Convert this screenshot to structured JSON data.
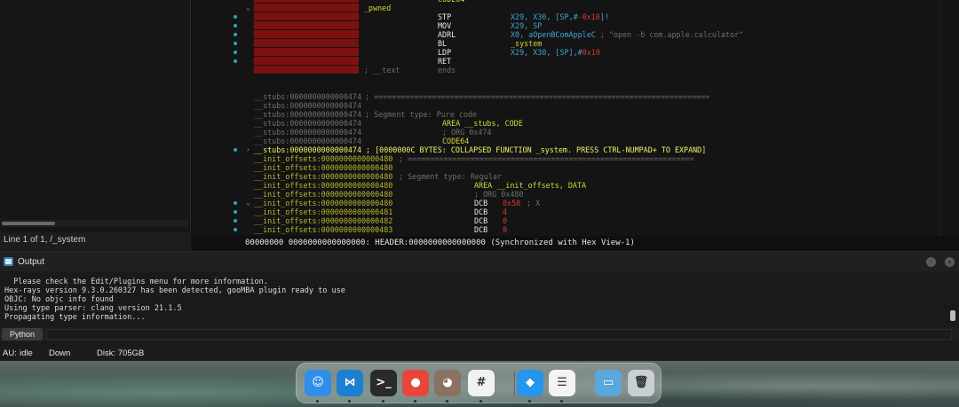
{
  "left_pane": {
    "status": "Line 1 of 1, /_system"
  },
  "disasm": {
    "top_lines": [
      {
        "label": "",
        "mnem": "",
        "ops": "CODE64",
        "ops_kind": "label"
      },
      {
        "label": "_pwned",
        "mnem": "",
        "ops": "",
        "ops_kind": ""
      },
      {
        "label": "",
        "mnem": "STP",
        "ops": "X29, X30, [SP,#-0x10]!",
        "ops_kind": "reg"
      },
      {
        "label": "",
        "mnem": "MOV",
        "ops": "X29, SP",
        "ops_kind": "reg"
      },
      {
        "label": "",
        "mnem": "ADRL",
        "ops": "X0, aOpenBComAppleC ; \"open -b com.apple.calculator\"",
        "ops_kind": "reg"
      },
      {
        "label": "",
        "mnem": "BL",
        "ops": "_system",
        "ops_kind": "label"
      },
      {
        "label": "",
        "mnem": "LDP",
        "ops": "X29, X30, [SP],#0x10",
        "ops_kind": "reg"
      },
      {
        "label": "",
        "mnem": "RET",
        "ops": "",
        "ops_kind": ""
      },
      {
        "label": "; __text",
        "mnem": "ends",
        "ops": "",
        "ops_kind": "cmt"
      }
    ],
    "stubs_lines": [
      {
        "addr": "__stubs:0000000000000474",
        "text": " ; ==========================================================================="
      },
      {
        "addr": "__stubs:0000000000000474",
        "text": ""
      },
      {
        "addr": "__stubs:0000000000000474",
        "text": " ; Segment type: Pure code"
      },
      {
        "addr": "__stubs:0000000000000474",
        "text": "",
        "mnem": "AREA __stubs, CODE"
      },
      {
        "addr": "__stubs:0000000000000474",
        "text": "",
        "mnem": "; ORG 0x474",
        "cmt": true
      },
      {
        "addr": "__stubs:0000000000000474",
        "text": "",
        "mnem": "CODE64"
      }
    ],
    "collapsed": "__stubs:0000000000000474 ; [0000000C BYTES: COLLAPSED FUNCTION _system. PRESS CTRL-NUMPAD+ TO EXPAND]",
    "init_lines": [
      {
        "addr": "__init_offsets:0000000000000480",
        "text": " ; ================================================================"
      },
      {
        "addr": "__init_offsets:0000000000000480",
        "text": ""
      },
      {
        "addr": "__init_offsets:0000000000000480",
        "text": " ; Segment type: Regular"
      },
      {
        "addr": "__init_offsets:0000000000000480",
        "text": "",
        "mnem": "AREA __init_offsets, DATA"
      },
      {
        "addr": "__init_offsets:0000000000000480",
        "text": "",
        "mnem": "; ORG 0x480",
        "cmt": true
      }
    ],
    "dcb_lines": [
      {
        "addr": "__init_offsets:0000000000000480",
        "val": "0x58",
        "cmt": " ; X"
      },
      {
        "addr": "__init_offsets:0000000000000481",
        "val": "4",
        "cmt": ""
      },
      {
        "addr": "__init_offsets:0000000000000482",
        "val": "0",
        "cmt": ""
      },
      {
        "addr": "__init_offsets:0000000000000483",
        "val": "0",
        "cmt": ""
      }
    ],
    "dcb_mnem": "DCB",
    "sync_bar": "00000000 0000000000000000: HEADER:0000000000000000 (Synchronized with Hex View-1)"
  },
  "output": {
    "title": "Output",
    "lines": [
      "  Please check the Edit/Plugins menu for more information.",
      "Hex-rays version 9.3.0.260327 has been detected, gooMBA plugin ready to use",
      "OBJC: No objc info found",
      "Using type parser: clang version 21.1.5",
      "Propagating type information..."
    ],
    "python_label": "Python"
  },
  "statusbar": {
    "au": "AU:",
    "state": "idle",
    "direction": "Down",
    "disk": "Disk: 705GB"
  },
  "dock": {
    "apps": [
      {
        "name": "finder",
        "glyph": "☺",
        "color": "#2f8ee8"
      },
      {
        "name": "vscode",
        "glyph": "⋈",
        "color": "#1c7fd0"
      },
      {
        "name": "terminal",
        "glyph": ">_",
        "color": "#2a2a2a"
      },
      {
        "name": "chrome",
        "glyph": "●",
        "color": "#e8463b"
      },
      {
        "name": "portrait-app",
        "glyph": "◕",
        "color": "#8a7262"
      },
      {
        "name": "slack",
        "glyph": "#",
        "color": "#f2f2f2"
      },
      {
        "name": "docker",
        "glyph": "◆",
        "color": "#2496ed"
      },
      {
        "name": "reminders",
        "glyph": "☰",
        "color": "#f4f4f4"
      },
      {
        "name": "folder",
        "glyph": "▭",
        "color": "#5aa7dc"
      },
      {
        "name": "trash",
        "glyph": "🗑",
        "color": "#c9cfd4"
      }
    ]
  }
}
